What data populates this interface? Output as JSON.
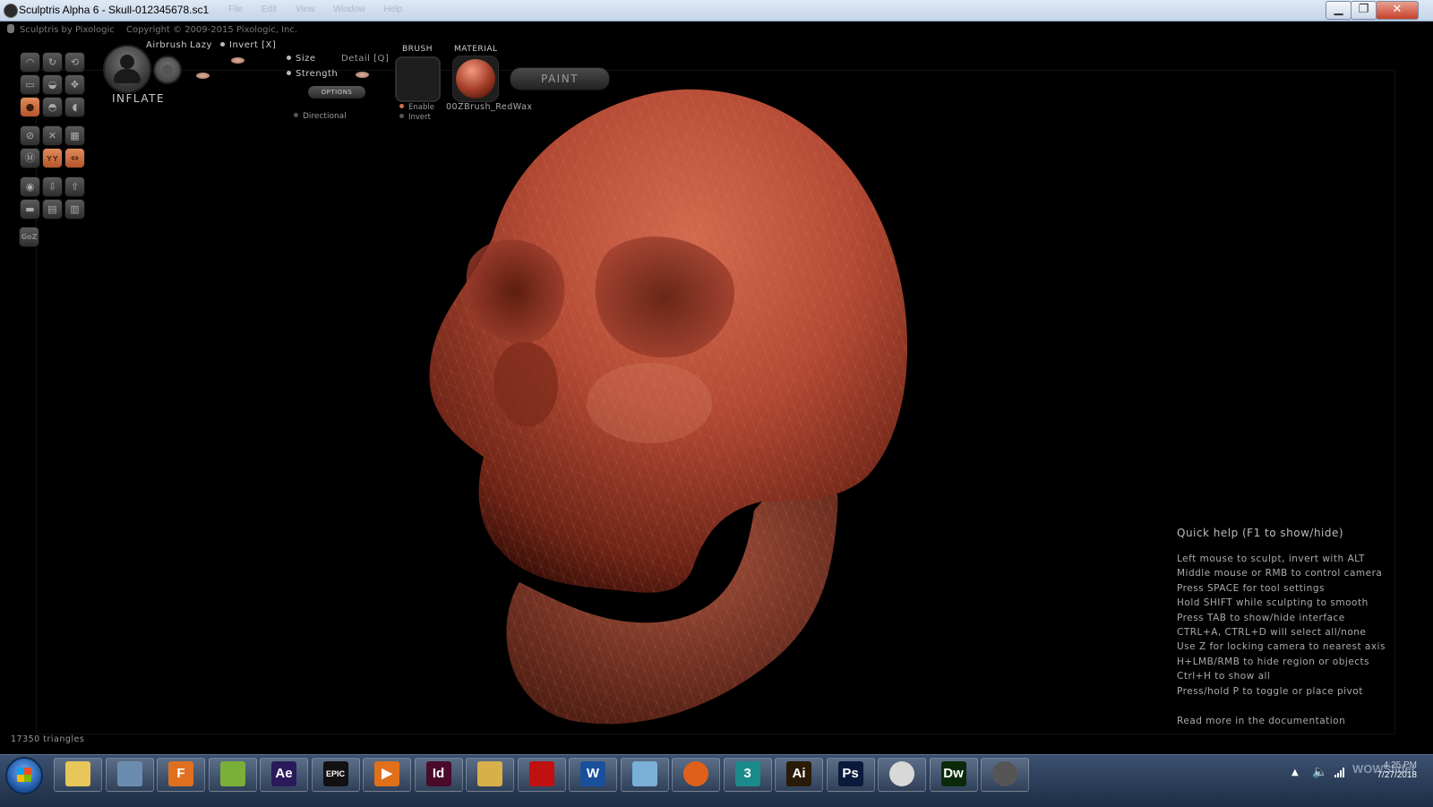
{
  "window": {
    "title": "Sculptris Alpha 6 - Skull-012345678.sc1",
    "ghost_menu": "File Edit View Window Help",
    "minimize": "▁",
    "maximize": "❐",
    "close": "✕"
  },
  "app_header": {
    "brand": "Sculptris by Pixologic",
    "copyright": "Copyright © 2009-2015 Pixologic, Inc."
  },
  "toolbar": {
    "tool_name": "INFLATE",
    "airbrush": "Airbrush",
    "lazy": "Lazy",
    "invert": "Invert [X]",
    "size": "Size",
    "detail": "Detail [Q]",
    "strength": "Strength",
    "options": "OPTIONS",
    "directional": "Directional",
    "brush_label": "BRUSH",
    "enable": "Enable",
    "brush_invert": "Invert",
    "material_label": "MATERIAL",
    "material_name": "00ZBrush_RedWax",
    "paint": "PAINT",
    "goz": "GoZ"
  },
  "tools": [
    {
      "icon": "draw-icon"
    },
    {
      "icon": "crease-icon"
    },
    {
      "icon": "rotate-icon"
    },
    {
      "icon": "flatten-icon"
    },
    {
      "icon": "pinch-icon"
    },
    {
      "icon": "grab-icon"
    },
    {
      "icon": "inflate-icon",
      "active": true
    },
    {
      "icon": "smooth-icon"
    },
    {
      "icon": "reduce-icon"
    },
    {
      "icon": "symmetry-icon"
    },
    {
      "icon": "wireframe-icon"
    },
    {
      "icon": "grid-icon"
    },
    {
      "icon": "mask-icon"
    },
    {
      "icon": "mirror-icon",
      "active": true
    },
    {
      "icon": "swap-icon",
      "active": true
    },
    {
      "icon": "sphere-icon"
    },
    {
      "icon": "import-icon"
    },
    {
      "icon": "export-icon"
    },
    {
      "icon": "plane-icon"
    },
    {
      "icon": "save-icon"
    },
    {
      "icon": "load-icon"
    }
  ],
  "quick_help": {
    "title": "Quick help (F1 to show/hide)",
    "lines": [
      "Left mouse to sculpt, invert with ALT",
      "Middle mouse or RMB to control camera",
      "Press SPACE for tool settings",
      "Hold SHIFT while sculpting to smooth",
      "Press TAB to show/hide interface",
      "CTRL+A, CTRL+D will select all/none",
      "Use Z for locking camera to nearest axis",
      "H+LMB/RMB to hide region or objects",
      "Ctrl+H to show all",
      "Press/hold P to toggle or place pivot"
    ],
    "more": "Read more in the documentation"
  },
  "status": {
    "triangles": "17350 triangles"
  },
  "taskbar": {
    "apps": [
      {
        "name": "file-explorer",
        "label": "",
        "bg": "#e8c65a"
      },
      {
        "name": "3d-viewer",
        "label": "",
        "bg": "#6a8caf"
      },
      {
        "name": "flash-builder",
        "label": "F",
        "bg": "#e07020"
      },
      {
        "name": "sticky-app",
        "label": "",
        "bg": "#7ab03a"
      },
      {
        "name": "after-effects",
        "label": "Ae",
        "bg": "#2a1a5a"
      },
      {
        "name": "epic-games",
        "label": "EPIC",
        "bg": "#111111"
      },
      {
        "name": "media-player",
        "label": "▶",
        "bg": "#e0701a"
      },
      {
        "name": "indesign",
        "label": "Id",
        "bg": "#4a0a2a"
      },
      {
        "name": "folder",
        "label": "",
        "bg": "#d8b04a"
      },
      {
        "name": "acrobat",
        "label": "",
        "bg": "#c01010"
      },
      {
        "name": "word",
        "label": "W",
        "bg": "#1a4f9c"
      },
      {
        "name": "photo-viewer",
        "label": "",
        "bg": "#7ab0d8"
      },
      {
        "name": "firefox",
        "label": "",
        "bg": "#e0601a"
      },
      {
        "name": "3ds-max",
        "label": "3",
        "bg": "#1a8a8a"
      },
      {
        "name": "illustrator",
        "label": "Ai",
        "bg": "#2a1a08"
      },
      {
        "name": "photoshop",
        "label": "Ps",
        "bg": "#0a1a3a"
      },
      {
        "name": "chrome",
        "label": "",
        "bg": "#d8d8d8"
      },
      {
        "name": "dreamweaver",
        "label": "Dw",
        "bg": "#0a2a0a"
      },
      {
        "name": "sculptris",
        "label": "",
        "bg": "#555555"
      }
    ],
    "time": "4:25 PM",
    "date": "7/27/2018",
    "watermark": "WOWSlider"
  }
}
